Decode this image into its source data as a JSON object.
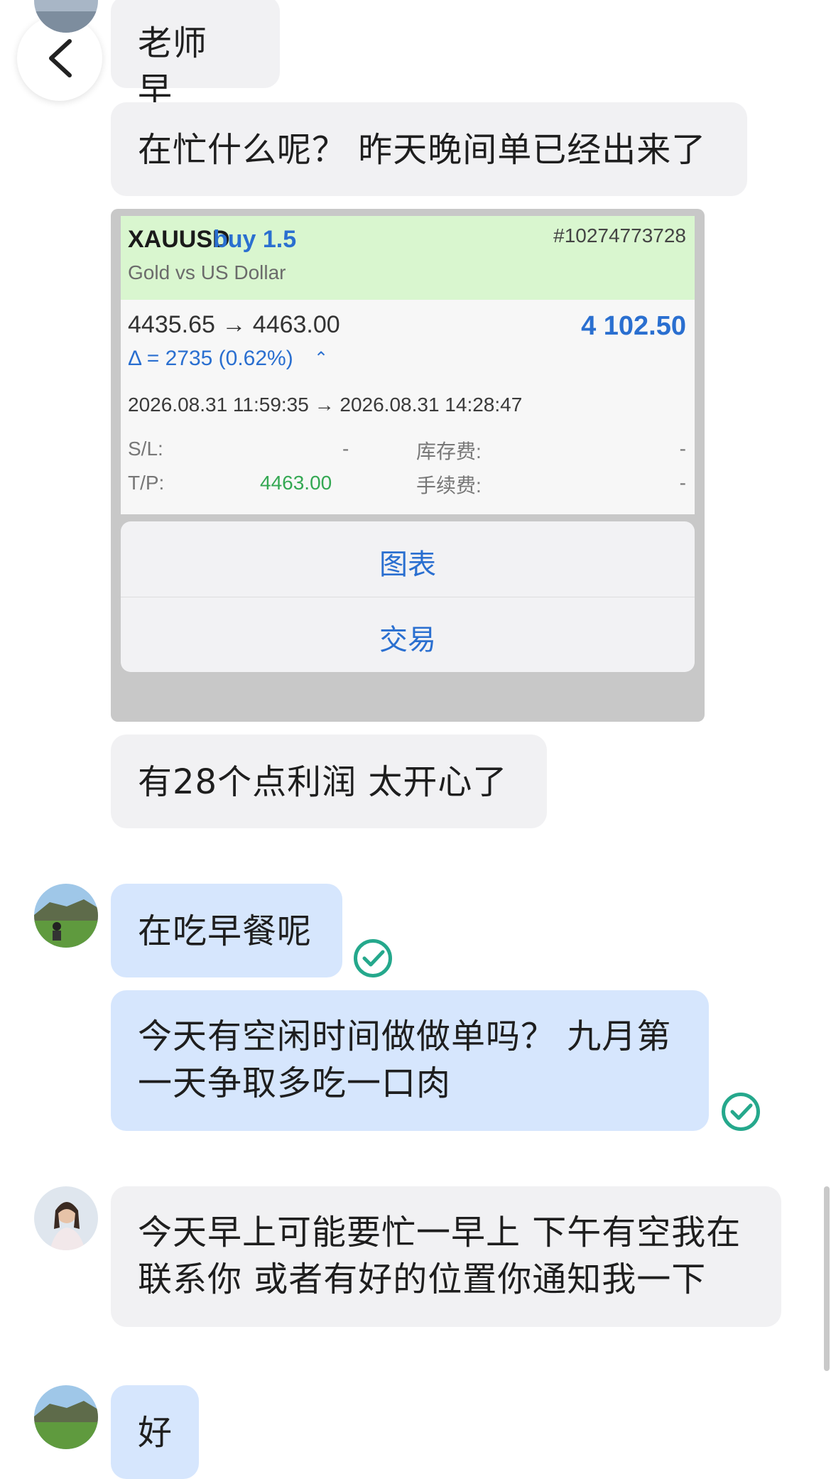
{
  "nav": {
    "back_icon": "chevron-left-icon"
  },
  "messages": [
    {
      "text": "老师 早"
    },
    {
      "text": "在忙什么呢？ 昨天晚间单已经出来了"
    },
    {
      "text": "有28个点利润 太开心了"
    },
    {
      "text": "在吃早餐呢"
    },
    {
      "text": "今天有空闲时间做做单吗？ 九月第一天争取多吃一口肉"
    },
    {
      "text": "今天早上可能要忙一早上 下午有空我在联系你 或者有好的位置你通知我一下"
    },
    {
      "text": "好"
    }
  ],
  "trade": {
    "symbol": "XAUUSD",
    "side": "buy 1.5",
    "ticket": "#10274773728",
    "description": "Gold vs US Dollar",
    "prices": "4435.65 → 4463.00",
    "profit": "4 102.50",
    "delta": "Δ = 2735 (0.62%)",
    "times": "2026.08.31 11:59:35 → 2026.08.31 14:28:47",
    "sl_label": "S/L:",
    "sl_value": "-",
    "tp_label": "T/P:",
    "tp_value": "4463.00",
    "swap_label": "库存费:",
    "swap_value": "-",
    "fee_label": "手续费:",
    "fee_value": "-"
  },
  "context_menu": {
    "items": [
      "图表",
      "交易"
    ]
  },
  "colors": {
    "accent_blue": "#2a6fd0",
    "check_green": "#25a88c",
    "bubble_blue": "#d6e6fd",
    "tp_green": "#34a853"
  }
}
